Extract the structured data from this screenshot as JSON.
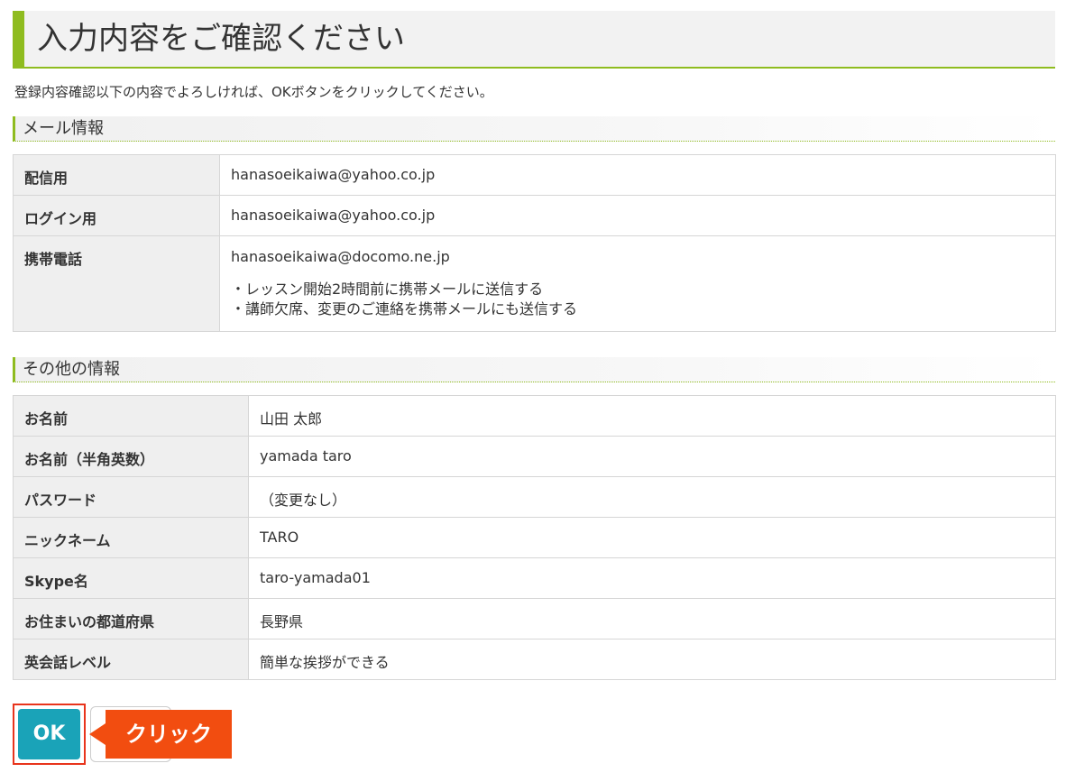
{
  "page": {
    "title": "入力内容をご確認ください",
    "intro": "登録内容確認以下の内容でよろしければ、OKボタンをクリックしてください。"
  },
  "mail_section": {
    "heading": "メール情報",
    "rows": [
      {
        "label": "配信用",
        "value": "hanasoeikaiwa@yahoo.co.jp"
      },
      {
        "label": "ログイン用",
        "value": "hanasoeikaiwa@yahoo.co.jp"
      },
      {
        "label": "携帯電話",
        "value": "hanasoeikaiwa@docomo.ne.jp",
        "notes": [
          "・レッスン開始2時間前に携帯メールに送信する",
          "・講師欠席、変更のご連絡を携帯メールにも送信する"
        ]
      }
    ]
  },
  "other_section": {
    "heading": "その他の情報",
    "rows": [
      {
        "label": "お名前",
        "value": "山田 太郎"
      },
      {
        "label": "お名前（半角英数）",
        "value": "yamada taro"
      },
      {
        "label": "パスワード",
        "value": "（変更なし）"
      },
      {
        "label": "ニックネーム",
        "value": "TARO"
      },
      {
        "label": "Skype名",
        "value": "taro-yamada01"
      },
      {
        "label": "お住まいの都道府県",
        "value": "長野県"
      },
      {
        "label": "英会話レベル",
        "value": "簡単な挨拶ができる"
      }
    ]
  },
  "actions": {
    "ok_label": "OK",
    "callout_text": "クリック"
  },
  "colors": {
    "accent_green": "#8fbc1f",
    "ok_button": "#1aa3b8",
    "callout": "#f24d10",
    "highlight_border": "#e8341c"
  }
}
